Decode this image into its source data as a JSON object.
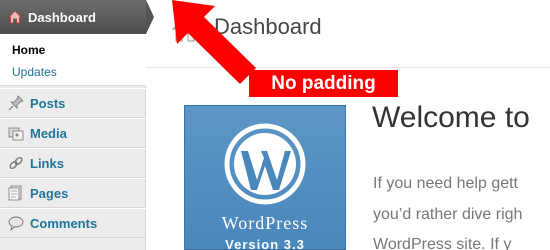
{
  "sidebar": {
    "dashboard_label": "Dashboard",
    "submenu": [
      {
        "label": "Home"
      },
      {
        "label": "Updates"
      }
    ],
    "items": [
      {
        "label": "Posts",
        "icon": "pin-icon"
      },
      {
        "label": "Media",
        "icon": "media-icon"
      },
      {
        "label": "Links",
        "icon": "link-icon"
      },
      {
        "label": "Pages",
        "icon": "pages-icon"
      },
      {
        "label": "Comments",
        "icon": "comment-icon"
      }
    ]
  },
  "header": {
    "title": "Dashboard"
  },
  "annotation": {
    "label": "No padding",
    "color": "#ff0000"
  },
  "welcome": {
    "title": "Welcome to",
    "lines": [
      "If you need help gett",
      "you’d rather dive righ",
      "WordPress site. If y"
    ],
    "logo_wordmark": "WordPress",
    "logo_version": "Version 3.3"
  },
  "colors": {
    "link": "#21759b",
    "menu_dark": "#545454",
    "logo_blue": "#5d96c6"
  }
}
